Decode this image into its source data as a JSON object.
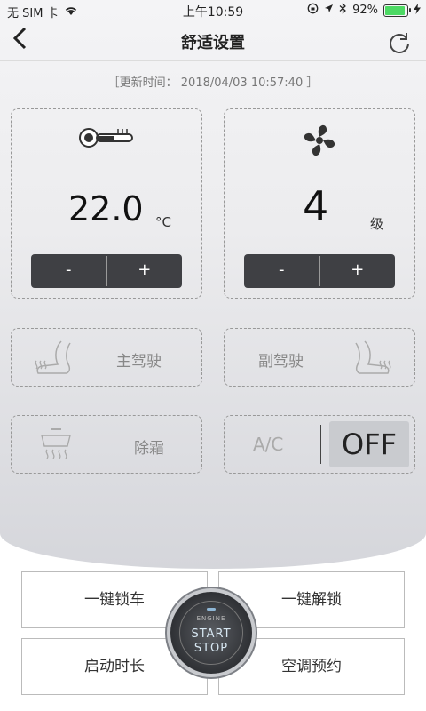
{
  "status_bar": {
    "carrier": "无 SIM 卡",
    "time": "上午10:59",
    "battery": "92%",
    "icons": [
      "wifi-icon",
      "lock-rotation-icon",
      "location-icon",
      "bluetooth-icon",
      "battery-icon",
      "charging-icon"
    ]
  },
  "nav": {
    "back_icon": "chevron-left-icon",
    "title": "舒适设置",
    "refresh_icon": "refresh-icon"
  },
  "updated": "［更新时间： 2018/04/03 10:57:40 ］",
  "temperature": {
    "icon": "thermometer-icon",
    "value": "22.0",
    "unit": "°C",
    "minus": "-",
    "plus": "+"
  },
  "fan": {
    "icon": "fan-icon",
    "value": "4",
    "unit": "级",
    "minus": "-",
    "plus": "+"
  },
  "seats": {
    "driver": "主驾驶",
    "passenger": "副驾驶",
    "icon": "heated-seat-icon"
  },
  "defrost": {
    "label": "除霜",
    "icon": "rear-defrost-icon"
  },
  "ac": {
    "label": "A/C",
    "state": "OFF"
  },
  "actions": {
    "lock": "一键锁车",
    "unlock": "一键解锁",
    "duration": "启动时长",
    "ac_schedule": "空调预约"
  },
  "engine_button": {
    "caption": "ENGINE",
    "line1": "START",
    "line2": "STOP"
  },
  "colors": {
    "stepper_bg": "#3f4044",
    "ac_state_bg": "#c9cbcf"
  }
}
